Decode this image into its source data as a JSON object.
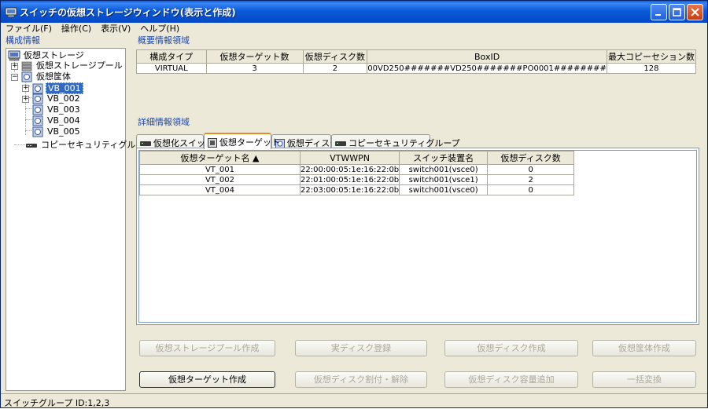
{
  "window": {
    "title": "スイッチの仮想ストレージウィンドウ(表示と作成)"
  },
  "menu": [
    "ファイル(F)",
    "操作(C)",
    "表示(V)",
    "ヘルプ(H)"
  ],
  "left": {
    "section_title": "構成情報",
    "tree": {
      "root": "仮想ストレージ",
      "pool": "仮想ストレージプール",
      "enclosure": "仮想筐体",
      "vb": [
        "VB_001",
        "VB_002",
        "VB_003",
        "VB_004",
        "VB_005"
      ],
      "copy_group": "コピーセキュリティグループ"
    }
  },
  "summary": {
    "section_title": "概要情報領域",
    "headers": [
      "構成タイプ",
      "仮想ターゲット数",
      "仮想ディスク数",
      "BoxID",
      "最大コピーセション数"
    ],
    "row": [
      "VIRTUAL",
      "3",
      "2",
      "00VD250#######VD250#######PO0001########",
      "128"
    ]
  },
  "detail": {
    "section_title": "詳細情報領域",
    "tabs": [
      "仮想化スイッチ",
      "仮想ターゲット",
      "仮想ディスク",
      "コピーセキュリティグループ"
    ],
    "headers": [
      "仮想ターゲット名 ▲",
      "VTWWPN",
      "スイッチ装置名",
      "仮想ディスク数"
    ],
    "rows": [
      [
        "VT_001",
        "22:00:00:05:1e:16:22:0b",
        "switch001(vsce0)",
        "0"
      ],
      [
        "VT_002",
        "22:01:00:05:1e:16:22:0b",
        "switch001(vsce1)",
        "2"
      ],
      [
        "VT_004",
        "22:03:00:05:1e:16:22:0b",
        "switch001(vsce0)",
        "0"
      ]
    ]
  },
  "buttons": {
    "row1": [
      "仮想ストレージプール作成",
      "実ディスク登録",
      "仮想ディスク作成",
      "仮想筐体作成"
    ],
    "row2": [
      "仮想ターゲット作成",
      "仮想ディスク割付・解除",
      "仮想ディスク容量追加",
      "一括変換"
    ]
  },
  "status": "スイッチグループ ID:1,2,3"
}
